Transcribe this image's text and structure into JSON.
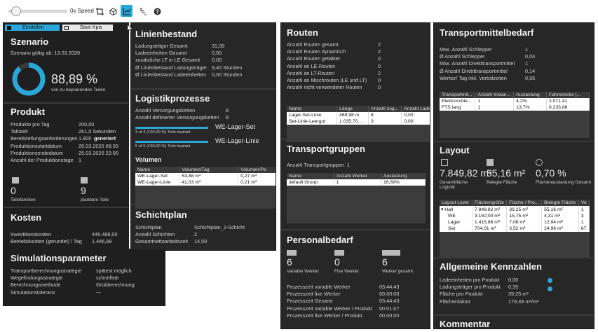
{
  "toolbar": {
    "speed_label": "0x Speed",
    "slider_value_fraction": 0.12
  },
  "left": {
    "btn_einstellen": "Einstellen",
    "btn_save": "Save Kpis",
    "szenario": {
      "title": "Szenario",
      "valid_label": "Szenario gültig ab:",
      "valid_date": "13.03.2020",
      "percent": "88,89 %",
      "percent_fraction": 0.8889,
      "percent_caption": "von zu beplanenden Teilen"
    },
    "produkt": {
      "title": "Produkt",
      "rows": [
        {
          "k": "Produkte pro Tag",
          "v": "200,00"
        },
        {
          "k": "Taktzeit",
          "v": "261,0 Sekunden"
        },
        {
          "k": "Bereitstellungsanforderungen",
          "v": "1.800",
          "extra": "generiert"
        },
        {
          "k": "Produktionsstartdatum",
          "v": "25.03.2020 06:00"
        },
        {
          "k": "Produktionsendedatum",
          "v": "25.03.2020 22:00"
        },
        {
          "k": "Anzahl der Produktionstage",
          "v": "1"
        }
      ],
      "count1": "0",
      "count1_label": "Teilefamilien",
      "count2": "9",
      "count2_label": "planbare Teile"
    },
    "kosten": {
      "title": "Kosten",
      "rows": [
        {
          "k": "Investitionskosten",
          "v": "446.488,00"
        },
        {
          "k": "Betriebskosten (gerundet) / Tag",
          "v": "1.446,88"
        }
      ]
    },
    "sim": {
      "title": "Simulationsparameter",
      "rows": [
        {
          "k": "Transportberechnungsstrategie",
          "v": "spätest möglich"
        },
        {
          "k": "Wegefindungsstrategie",
          "v": "schnellste"
        },
        {
          "k": "Berechnungsmethode",
          "v": "Grobberechnung"
        },
        {
          "k": "Simulationstoleranz",
          "v": "---"
        }
      ]
    }
  },
  "linien": {
    "title": "Linienbestand",
    "rows": [
      {
        "k": "Ladungsträger Gesamt",
        "v": "31,00"
      },
      {
        "k": "Ladeeinheiten Gesamt",
        "v": "0,00"
      },
      {
        "k": "zusätzliche LT in LE Gesamt",
        "v": "0,00"
      },
      {
        "k": "Ø Linienbestand Ladungsträger",
        "v": "9,40 Stunden"
      },
      {
        "k": "Ø Linienbestand Ladeeinheiten",
        "v": "0,00 Stunden"
      }
    ]
  },
  "logistik": {
    "title": "Logistikprozesse",
    "rows": [
      {
        "k": "Anzahl Versorgungsketten",
        "v": "8"
      },
      {
        "k": "Anzahl definierter Versorgungsketten",
        "v": "8"
      }
    ],
    "bars": [
      {
        "name": "WE-Lager-Set",
        "caption": "3 of 3 (100,00 %) Teile beplant",
        "fraction": 1.0
      },
      {
        "name": "WE-Lager-Linie",
        "caption": "5 of 5 (100,00 %) Teile beplant",
        "fraction": 1.0
      }
    ],
    "volumen_title": "Volumen",
    "table": {
      "headers": [
        "Name",
        "Volumen/Tag",
        "Volumen/Pe"
      ],
      "rows": [
        [
          "WE-Lager-Set",
          "53,88 m³",
          "0,27 m³"
        ],
        [
          "WE-Lager-Linie",
          "41,03 m³",
          "0,21 m³"
        ]
      ]
    }
  },
  "schicht": {
    "title": "Schichtplan",
    "rows": [
      {
        "k": "Schichtplan",
        "v": "Schichtplan_2-Schicht"
      },
      {
        "k": "Anzahl Schichten",
        "v": "2"
      },
      {
        "k": "Gesamtnettoarbeitszeit",
        "v": "14,50"
      }
    ]
  },
  "routen": {
    "title": "Routen",
    "rows": [
      {
        "k": "Anzahl Routen gesamt",
        "v": "2"
      },
      {
        "k": "Anzahl Routen dynamisch",
        "v": "2"
      },
      {
        "k": "Anzahl Routen getaktet",
        "v": "0"
      },
      {
        "k": "Anzahl an LE-Routen",
        "v": "0"
      },
      {
        "k": "Anzahl an LT-Routen",
        "v": "2"
      },
      {
        "k": "Anzahl an Mischrouten (LE und LT)",
        "v": "0"
      },
      {
        "k": "Anzahl nicht verwendeter Routen",
        "v": "0"
      }
    ],
    "table": {
      "headers": [
        "Name",
        "Länge",
        "Anzahl zug...",
        "Anzahl Ladee"
      ],
      "rows": [
        [
          "Lager-Set-Linie",
          "469,98 m",
          "8",
          "0,00"
        ],
        [
          "Set-Linie-Leergut",
          "1.035,70...",
          "3",
          "0,00"
        ]
      ]
    }
  },
  "tgruppen": {
    "title": "Transportgruppen",
    "count_label": "Anzahl Transportgruppen",
    "count": "1",
    "table": {
      "headers": [
        "Name",
        "Anzahl Werker",
        "Auslastung"
      ],
      "rows": [
        [
          "default Group",
          "1",
          "16,69%"
        ]
      ]
    }
  },
  "personal": {
    "title": "Personalbedarf",
    "kpis": [
      {
        "value": "6",
        "label": "Variable Werker"
      },
      {
        "value": "0",
        "label": "Fixe Werker"
      },
      {
        "value": "6",
        "label": "Werker gesamt"
      }
    ],
    "rows": [
      {
        "k": "Prozesszeit variable Werker",
        "v": "03:44:43"
      },
      {
        "k": "Prozesszeit fixe Werker",
        "v": "00:00:00"
      },
      {
        "k": "Prozesszeit Gesamt",
        "v": "03:44:43"
      },
      {
        "k": "Prozesszeit variable Werker / Produkt",
        "v": "00:01:07"
      },
      {
        "k": "Prozesszeit fixe Werker / Produkt",
        "v": "00:00:00"
      }
    ]
  },
  "tmb": {
    "title": "Transportmittelbedarf",
    "rows": [
      {
        "k": "Max. Anzahl Schlepper",
        "v": "1"
      },
      {
        "k": "Ø Anzahl Schlepper",
        "v": "0,04"
      },
      {
        "k": "Max. Anzahl Direkttransportmittel",
        "v": "1"
      },
      {
        "k": "Ø Anzahl Direkttransportmittel",
        "v": "0,14"
      },
      {
        "k": "Werker/ Tag inkl. Verteilzeiten",
        "v": "0,05"
      }
    ],
    "table": {
      "headers": [
        "Transportmit...",
        "Anzahl Instan...",
        "Auslastung",
        "Fahrstrecke [..."
      ],
      "rows": [
        [
          "Elektroschle...",
          "1",
          "4,2%",
          "2.071,41"
        ],
        [
          "FTS lang",
          "1",
          "13,7%",
          "8.233,86"
        ]
      ]
    }
  },
  "layout": {
    "title": "Layout",
    "kpis": [
      {
        "value": "7.849,82 m²",
        "label": "Gesamtfläche Logistik"
      },
      {
        "value": "55,16 m²",
        "label": "Belegte Fläche"
      },
      {
        "value": "0,70 %",
        "label": "Flächenauslastung Gesamt"
      }
    ],
    "table": {
      "headers": [
        "Layout Level",
        "Flächengröße",
        "Fläche / Pro...",
        "Belegte Fläche",
        "Ve"
      ],
      "rows": [
        [
          "Hall",
          "7.849,82 m²",
          "39,25 m²",
          "55,16 m²",
          "1"
        ],
        [
          "WE",
          "3.150,00 m²",
          "15,75 m²",
          "4,31 m²",
          "3"
        ],
        [
          "Lager",
          "1.415,86 m²",
          "7,08 m²",
          "12,94 m²",
          "1"
        ],
        [
          "Set",
          "704,01 m²",
          "3,52 m²",
          "24,96 m²",
          "67"
        ]
      ]
    }
  },
  "allg": {
    "title": "Allgemeine Kennzahlen",
    "rows": [
      {
        "k": "Ladeeinheiten pro Produkt",
        "v": "0,00"
      },
      {
        "k": "Ladungsträger pro Produkt",
        "v": "0,35"
      },
      {
        "k": "Fläche pro Produkt",
        "v": "39,25 m²"
      },
      {
        "k": "Flächenfaktor",
        "v": "179,49 m²/m³"
      }
    ]
  },
  "kommentar": {
    "title": "Kommentar"
  },
  "colors": {
    "accent": "#2aa6d8",
    "panel_bg": "#232323"
  }
}
